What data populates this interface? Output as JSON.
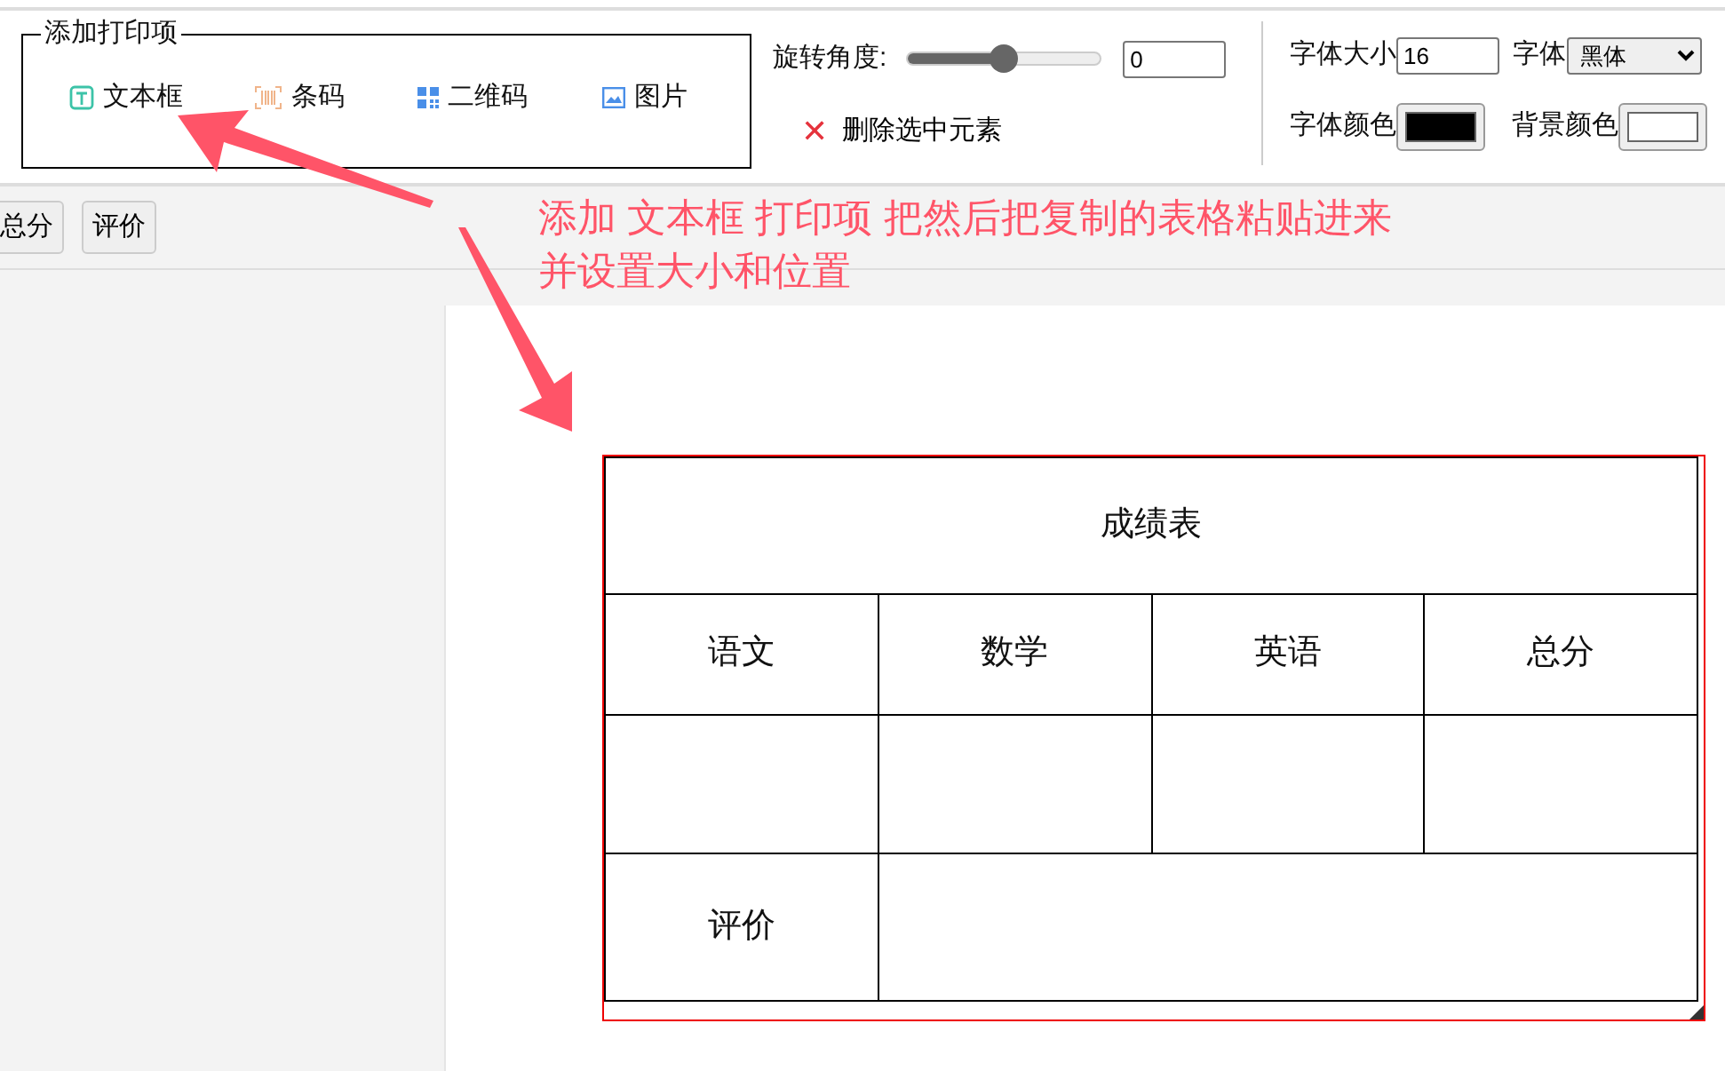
{
  "add_print_items": {
    "legend": "添加打印项",
    "items": [
      {
        "label": "文本框",
        "kind": "textbox"
      },
      {
        "label": "条码",
        "kind": "barcode"
      },
      {
        "label": "二维码",
        "kind": "qrcode"
      },
      {
        "label": "图片",
        "kind": "image"
      }
    ]
  },
  "rotation": {
    "label": "旋转角度:",
    "level": 0.5,
    "value": "0"
  },
  "delete_button": {
    "icon": "✕",
    "label": "删除选中元素"
  },
  "font_size": {
    "label": "字体大小",
    "value": "16"
  },
  "font": {
    "label": "字体",
    "value": "黑体"
  },
  "font_color": {
    "label": "字体颜色",
    "color": "#000000"
  },
  "background_color": {
    "label": "背景颜色",
    "color": "#ffffff"
  },
  "toolbar_buttons": [
    "总分",
    "评价"
  ],
  "annotation": {
    "lines": [
      "添加 文本框 打印项  把然后把复制的表格粘贴进来",
      "并设置大小和位置"
    ]
  },
  "table": {
    "title": "成绩表",
    "columns": [
      "语文",
      "数学",
      "英语",
      "总分"
    ],
    "comment_label": "评价"
  }
}
